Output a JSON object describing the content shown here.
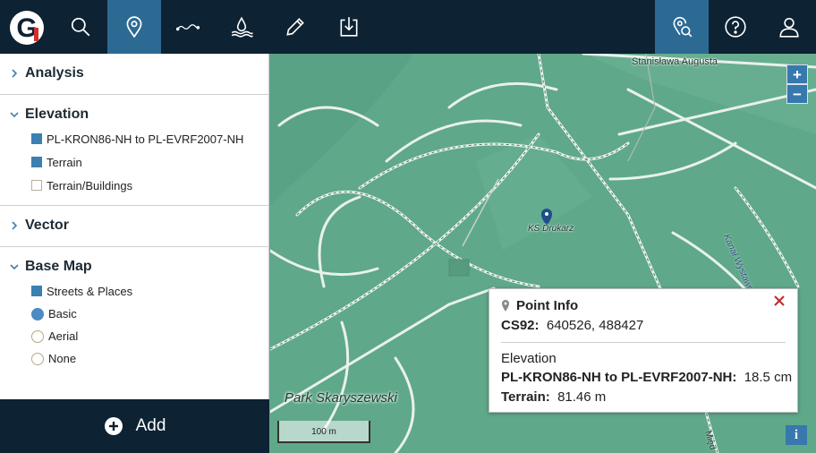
{
  "app": {
    "logo_letter": "G"
  },
  "toolbar": {
    "buttons": [
      {
        "name": "search",
        "icon": "search-icon",
        "active": false
      },
      {
        "name": "place",
        "icon": "map-pin-icon",
        "active": true
      },
      {
        "name": "profile",
        "icon": "profile-wave-icon",
        "active": false
      },
      {
        "name": "flood",
        "icon": "water-level-icon",
        "active": false
      },
      {
        "name": "draw",
        "icon": "pencil-icon",
        "active": false
      },
      {
        "name": "download",
        "icon": "download-icon",
        "active": false
      },
      {
        "name": "identify",
        "icon": "map-info-icon",
        "active": true
      },
      {
        "name": "help",
        "icon": "help-icon",
        "active": false
      },
      {
        "name": "account",
        "icon": "user-icon",
        "active": false
      }
    ]
  },
  "sidebar": {
    "sections": [
      {
        "title": "Analysis",
        "expanded": false
      },
      {
        "title": "Elevation",
        "expanded": true,
        "items": [
          {
            "label": "PL-KRON86-NH to PL-EVRF2007-NH",
            "checked": true
          },
          {
            "label": "Terrain",
            "checked": true
          },
          {
            "label": "Terrain/Buildings",
            "checked": false
          }
        ]
      },
      {
        "title": "Vector",
        "expanded": false
      },
      {
        "title": "Base Map",
        "expanded": true,
        "items": [
          {
            "label": "Streets & Places",
            "checked": true
          }
        ],
        "radios": [
          {
            "label": "Basic",
            "selected": true
          },
          {
            "label": "Aerial",
            "selected": false
          },
          {
            "label": "None",
            "selected": false
          }
        ]
      }
    ],
    "add_label": "Add"
  },
  "map": {
    "zoom_in": "+",
    "zoom_out": "−",
    "info": "i",
    "scale": "100 m",
    "labels": {
      "park": "Park Skaryszewski",
      "place": "KS Drukarz",
      "street": "Stanisława Augusta",
      "canal": "Kanał Wystawowy",
      "street2": "Międ"
    }
  },
  "popup": {
    "title": "Point Info",
    "coord_key": "CS92:",
    "coord_value": "640526, 488427",
    "section": "Elevation",
    "rows": [
      {
        "key": "PL-KRON86-NH to PL-EVRF2007-NH:",
        "value": "18.5 cm"
      },
      {
        "key": "Terrain:",
        "value": "81.46 m"
      }
    ]
  },
  "colors": {
    "toolbar": "#0d2233",
    "active": "#2c6a93",
    "map": "#5fa88a",
    "accent": "#3c7fb1",
    "close": "#c62828"
  }
}
